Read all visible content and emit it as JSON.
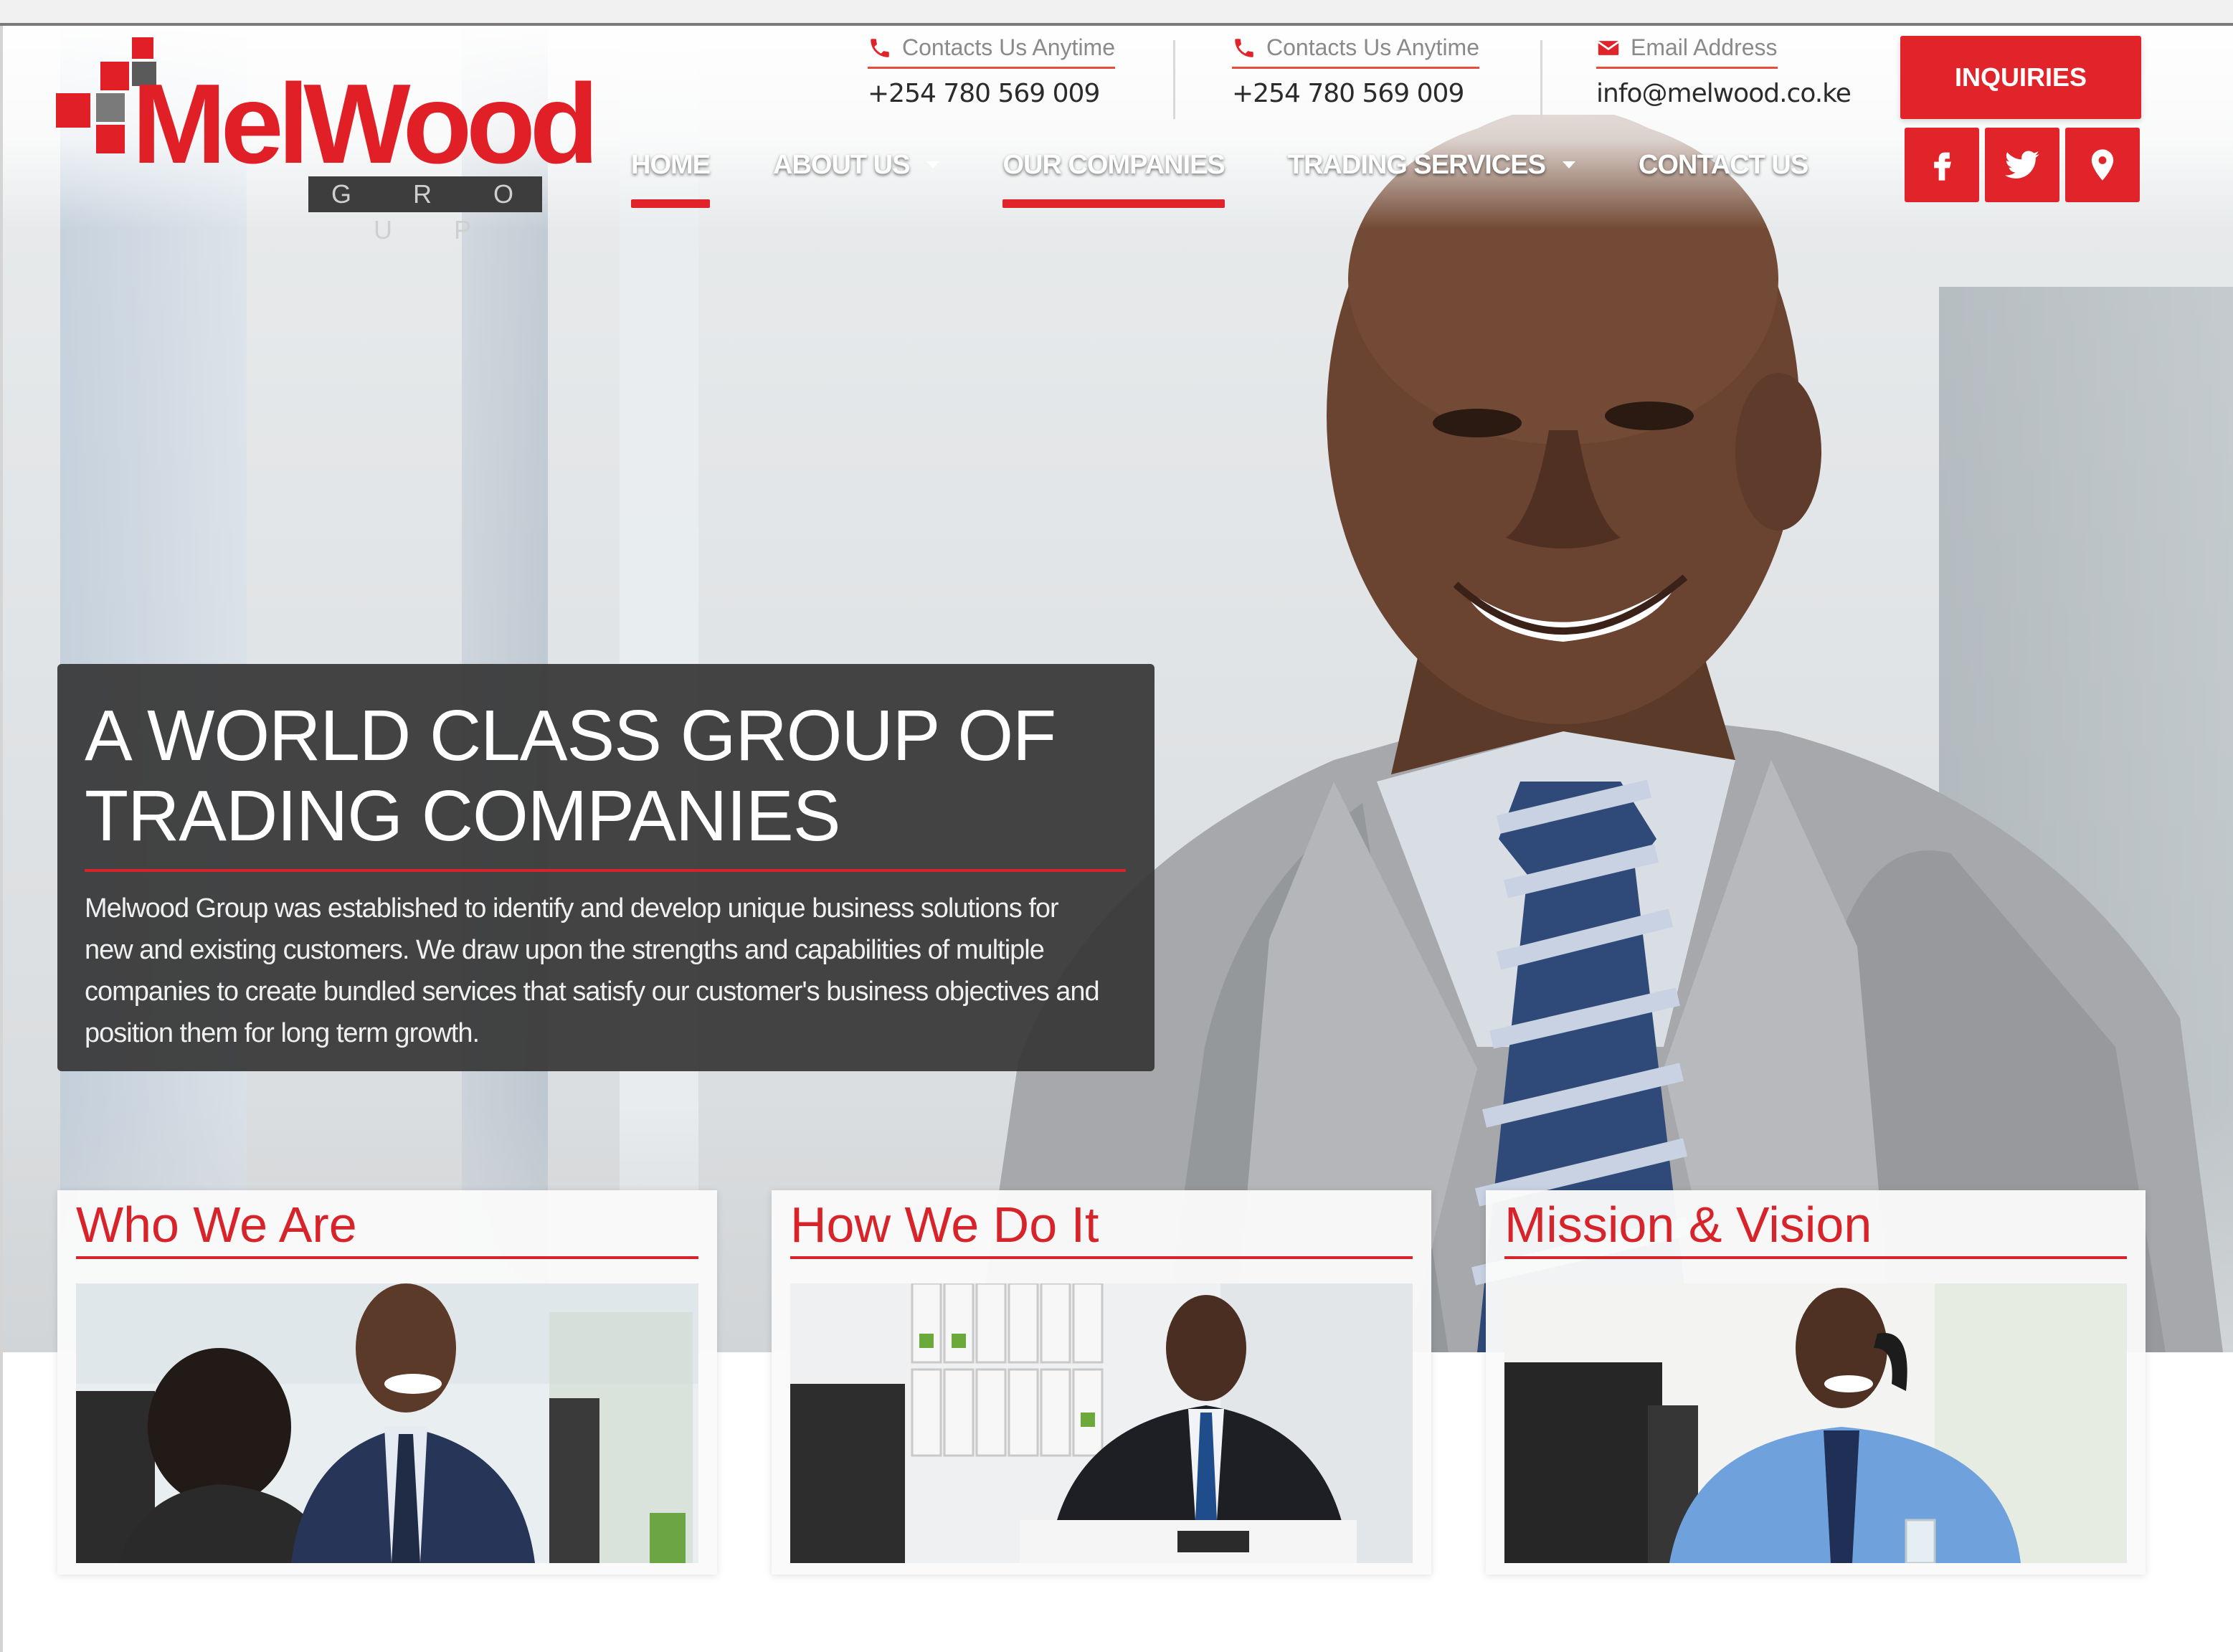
{
  "header": {
    "logo_text": "MelWood",
    "logo_subtext": "G R O U P",
    "contacts": [
      {
        "label": "Contacts Us Anytime",
        "value": "+254 780 569 009",
        "icon": "phone-icon"
      },
      {
        "label": "Contacts Us Anytime",
        "value": "+254 780 569 009",
        "icon": "phone-icon"
      },
      {
        "label": "Email Address",
        "value": "info@melwood.co.ke",
        "icon": "envelope-icon"
      }
    ],
    "inquiries_label": "INQUIRIES",
    "social": [
      "facebook-icon",
      "twitter-icon",
      "location-pin-icon"
    ]
  },
  "nav": {
    "items": [
      {
        "label": "HOME",
        "active": true,
        "dropdown": false
      },
      {
        "label": "ABOUT US",
        "active": false,
        "dropdown": true
      },
      {
        "label": "OUR COMPANIES",
        "active": true,
        "dropdown": false
      },
      {
        "label": "TRADING SERVICES",
        "active": false,
        "dropdown": true
      },
      {
        "label": "CONTACT US",
        "active": false,
        "dropdown": false
      }
    ]
  },
  "hero": {
    "title_line1": "A WORLD CLASS GROUP OF",
    "title_line2": "TRADING COMPANIES",
    "body_line1": "Melwood Group was established to identify and develop unique business solutions for",
    "body_line2": "new and existing customers. We draw upon the strengths and capabilities of multiple",
    "body_line3": "companies to create bundled services that satisfy our customer's business objectives and",
    "body_line4": "position them for long term growth."
  },
  "cards": [
    {
      "title": "Who We Are"
    },
    {
      "title": "How We Do It"
    },
    {
      "title": "Mission & Vision"
    }
  ],
  "colors": {
    "accent": "#e0242a",
    "caption_bg": "#373737",
    "nav_text": "#ffffff"
  }
}
